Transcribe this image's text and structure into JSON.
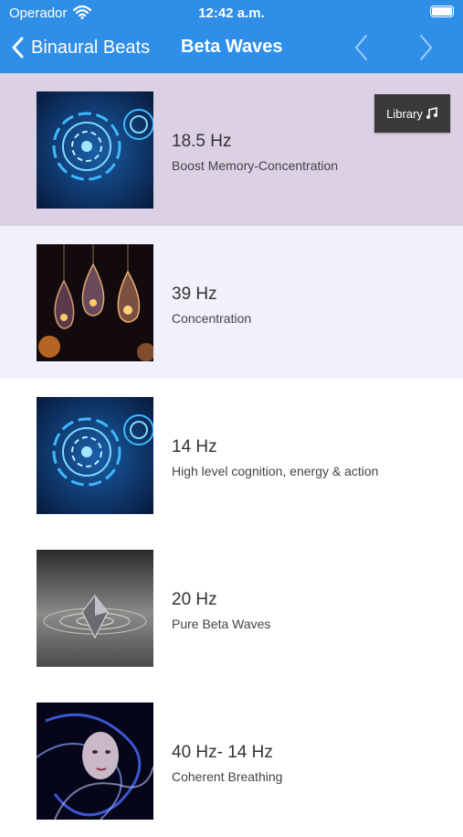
{
  "status_bar": {
    "carrier": "Operador",
    "time": "12:42 a.m."
  },
  "nav": {
    "back_label": "Binaural Beats",
    "title": "Beta Waves"
  },
  "library_button": {
    "label": "Library"
  },
  "colors": {
    "header": "#2f8ee8",
    "selected_row": "#dcd0e4",
    "alt_row": "#f1f0fb"
  },
  "items": [
    {
      "hz": "18.5 Hz",
      "desc": "Boost Memory-Concentration",
      "image": "blue-tech-circle"
    },
    {
      "hz": "39 Hz",
      "desc": "Concentration",
      "image": "glass-bulbs"
    },
    {
      "hz": "14 Hz",
      "desc": "High level cognition, energy & action",
      "image": "blue-tech-circle"
    },
    {
      "hz": "20 Hz",
      "desc": "Pure Beta Waves",
      "image": "water-diamond"
    },
    {
      "hz": "40 Hz- 14 Hz",
      "desc": "Coherent Breathing",
      "image": "woman-smoke"
    }
  ]
}
